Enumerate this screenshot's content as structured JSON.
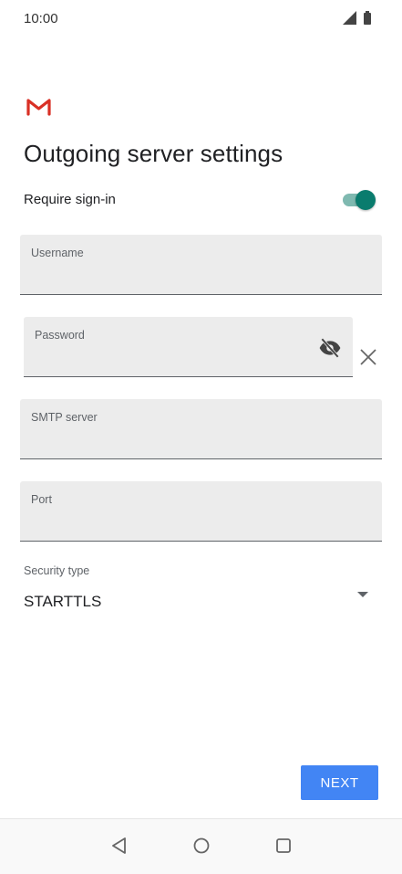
{
  "status_bar": {
    "time": "10:00"
  },
  "app": {
    "logo_icon": "gmail-logo-icon",
    "brand_color": "#d93025"
  },
  "page": {
    "title": "Outgoing server settings"
  },
  "require_signin": {
    "label": "Require sign-in",
    "enabled": true,
    "accent": "#0a7c6e"
  },
  "fields": {
    "username": {
      "label": "Username",
      "value": ""
    },
    "password": {
      "label": "Password",
      "value": ""
    },
    "smtp_server": {
      "label": "SMTP server",
      "value": ""
    },
    "port": {
      "label": "Port",
      "value": ""
    }
  },
  "security": {
    "label": "Security type",
    "selected": "STARTTLS"
  },
  "actions": {
    "next_label": "NEXT",
    "next_color": "#4285f4"
  },
  "nav": {
    "back_icon": "back-triangle-icon",
    "home_icon": "home-circle-icon",
    "recents_icon": "recents-square-icon"
  }
}
